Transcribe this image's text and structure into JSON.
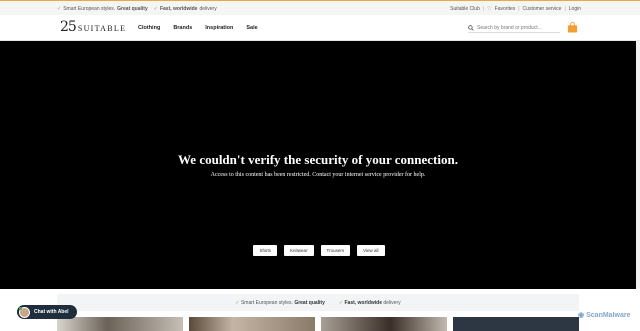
{
  "topbar": {
    "usp1_normal": "Smart European styles.",
    "usp1_bold": "Great quality",
    "usp2_bold": "Fast, worldwide",
    "usp2_normal": "delivery",
    "links": [
      "Suitable Club",
      "Favorites",
      "Customer service",
      "Login"
    ]
  },
  "header": {
    "logo_number": "25",
    "logo_word": "SUITABLE",
    "nav": [
      "Clothing",
      "Brands",
      "Inspiration",
      "Sale"
    ],
    "search_placeholder": "Search by brand or product...",
    "bag_color": "#f0a033"
  },
  "hero": {
    "title": "We couldn't verify the security of your connection.",
    "message": "Access to this content has been restricted. Contact your internet service provider for help.",
    "categories": [
      "Shirts",
      "Knitwear",
      "Trousers",
      "View all"
    ]
  },
  "usp_bar": {
    "usp1_normal": "Smart European styles.",
    "usp1_bold": "Great quality",
    "usp2_bold": "Fast, worldwide",
    "usp2_normal": "delivery"
  },
  "chat": {
    "label": "Chat with Abel"
  },
  "watermark": {
    "label": "ScanMalware"
  }
}
